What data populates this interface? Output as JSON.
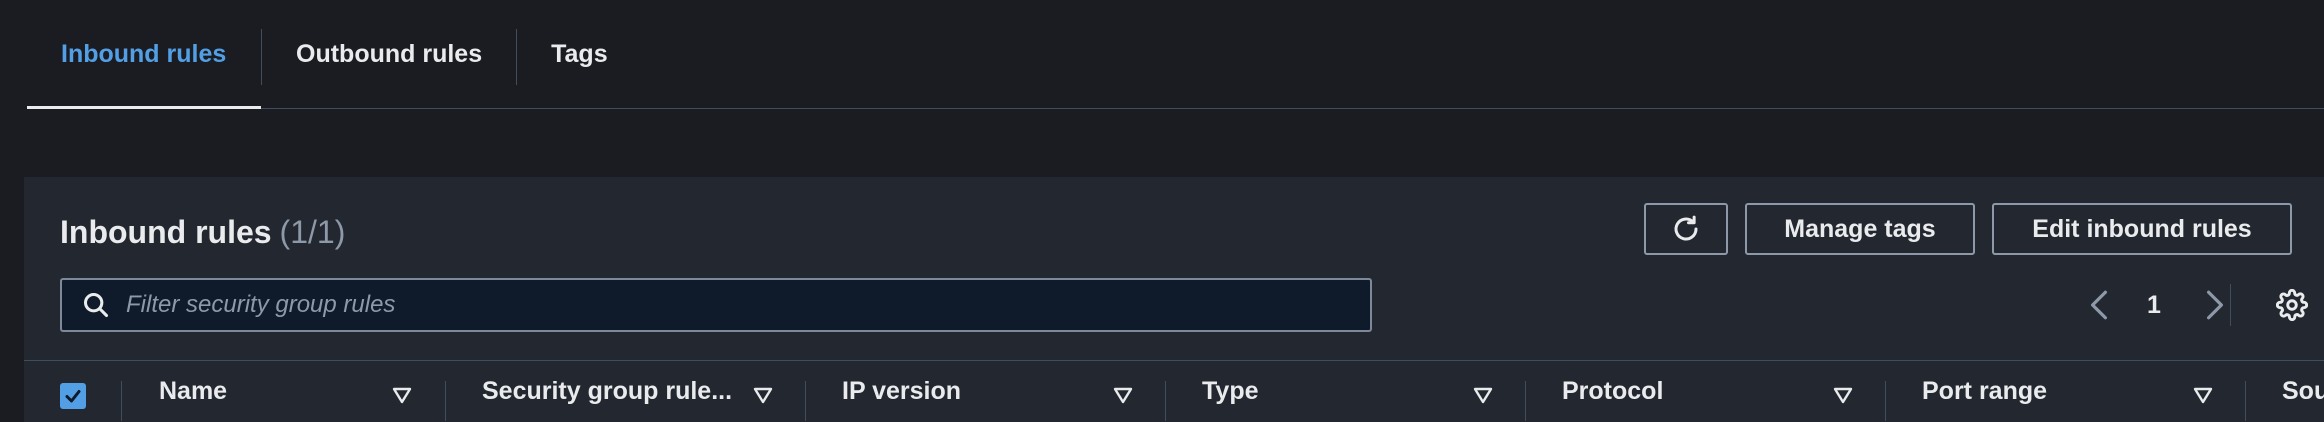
{
  "tabs": [
    {
      "label": "Inbound rules",
      "active": true
    },
    {
      "label": "Outbound rules",
      "active": false
    },
    {
      "label": "Tags",
      "active": false
    }
  ],
  "panel": {
    "title": "Inbound rules",
    "count": "(1/1)",
    "refresh_icon": "refresh-icon",
    "manage_tags_label": "Manage tags",
    "edit_rules_label": "Edit inbound rules",
    "search_placeholder": "Filter security group rules",
    "page_number": "1"
  },
  "table": {
    "select_all_checked": true,
    "columns": [
      "Name",
      "Security group rule...",
      "IP version",
      "Type",
      "Protocol",
      "Port range",
      "Sou"
    ]
  },
  "colors": {
    "accent": "#539fe5",
    "background": "#1b1c22",
    "panel": "#232730",
    "text": "#e9ebed",
    "muted": "#8d99a8"
  }
}
